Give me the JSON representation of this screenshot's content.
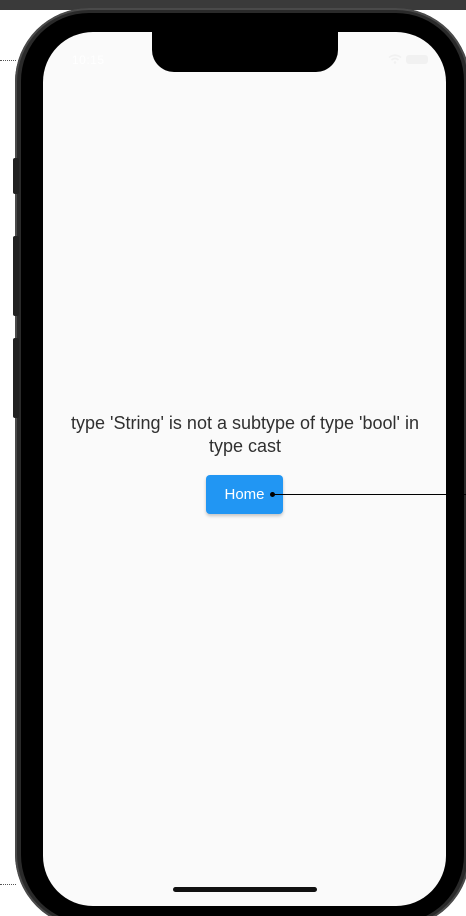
{
  "status_bar": {
    "time": "10:15",
    "icons": [
      "wifi-icon",
      "battery-icon"
    ]
  },
  "error": {
    "message": "type 'String' is not a subtype of type 'bool' in type cast"
  },
  "actions": {
    "home_label": "Home"
  },
  "colors": {
    "button": "#2196f3",
    "screen_background": "#fafafa",
    "text": "#303030"
  }
}
